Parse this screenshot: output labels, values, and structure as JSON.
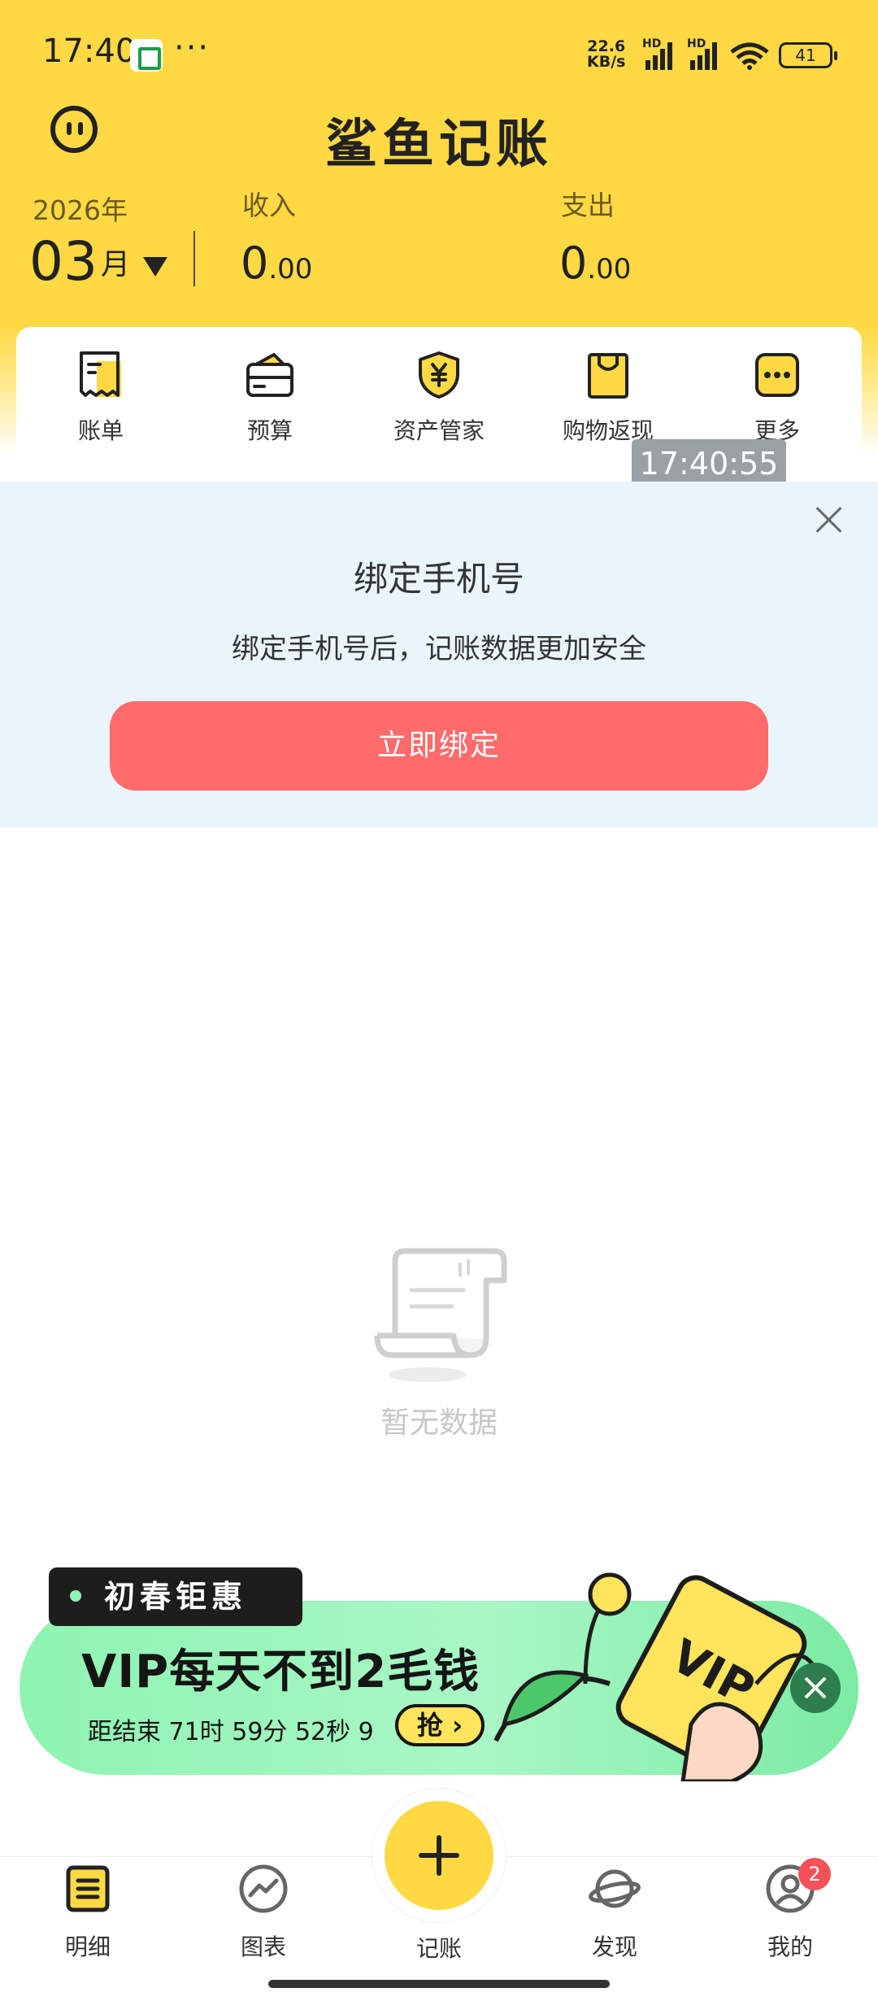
{
  "status_bar": {
    "time": "17:40",
    "more": "···",
    "net_speed_value": "22.6",
    "net_speed_unit": "KB/s",
    "hd": "HD",
    "battery": "41"
  },
  "header": {
    "app_title": "鲨鱼记账",
    "year": "2026年",
    "month": "03",
    "month_unit": "月",
    "income_label": "收入",
    "income_value_int": "0",
    "income_value_dec": ".00",
    "expense_label": "支出",
    "expense_value_int": "0",
    "expense_value_dec": ".00"
  },
  "tools": [
    {
      "label": "账单",
      "icon": "bill-icon"
    },
    {
      "label": "预算",
      "icon": "wallet-icon"
    },
    {
      "label": "资产管家",
      "icon": "shield-yen-icon"
    },
    {
      "label": "购物返现",
      "icon": "shopping-bag-icon"
    },
    {
      "label": "更多",
      "icon": "more-icon"
    }
  ],
  "timestamp": "17:40:55",
  "bind_phone": {
    "title": "绑定手机号",
    "description": "绑定手机号后，记账数据更加安全",
    "button": "立即绑定"
  },
  "empty_state": {
    "text": "暂无数据"
  },
  "vip_promo": {
    "tag": "初春钜惠",
    "headline": "VIP每天不到2毛钱",
    "countdown": "距结束 71时 59分 52秒 9",
    "grab_button": "抢",
    "card_text": "VIP"
  },
  "bottom_nav": {
    "items": [
      {
        "label": "明细",
        "icon": "list-icon"
      },
      {
        "label": "图表",
        "icon": "chart-icon"
      },
      {
        "label": "记账",
        "icon": "plus-icon"
      },
      {
        "label": "发现",
        "icon": "planet-icon"
      },
      {
        "label": "我的",
        "icon": "user-icon"
      }
    ],
    "badge_count": "2"
  },
  "colors": {
    "header_yellow": "#FFD944",
    "bind_button": "#FF6B6B",
    "banner_bg": "#EAF5FB",
    "vip_green": "#8EF4B2",
    "badge_red": "#F4525A"
  }
}
